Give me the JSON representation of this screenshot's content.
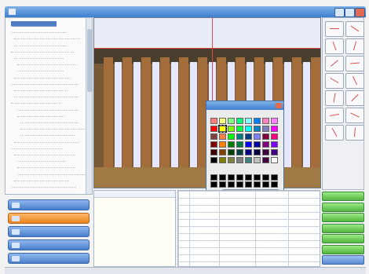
{
  "window": {
    "title": ""
  },
  "tree": {
    "rows": [
      "",
      "",
      "",
      "",
      "",
      "",
      "",
      "",
      "",
      "",
      "",
      "",
      "",
      "",
      "",
      "",
      "",
      "",
      "",
      "",
      "",
      "",
      "",
      "",
      "",
      ""
    ]
  },
  "left_buttons": [
    {
      "label": "",
      "icon": "camera-icon"
    },
    {
      "label": "",
      "icon": "measure-icon"
    },
    {
      "label": "",
      "icon": "folder-icon"
    },
    {
      "label": "",
      "icon": "image-icon"
    },
    {
      "label": "",
      "icon": "report-icon"
    }
  ],
  "toolbar": {
    "tools": [
      "pointer-tool-icon",
      "zoom-tool-icon",
      "line-tool-icon",
      "rect-tool-icon",
      "circle-tool-icon",
      "arc-tool-icon",
      "angle-tool-icon",
      "polygon-tool-icon",
      "curve-tool-icon",
      "text-tool-icon",
      "cross-tool-icon",
      "count-tool-icon",
      "point-tool-icon",
      "area-tool-icon"
    ]
  },
  "color_dialog": {
    "title": "",
    "basic_label": "",
    "custom_label": "",
    "define_label": "",
    "ok_label": "",
    "cancel_label": "",
    "basic_colors": [
      "#ff8080",
      "#ffff80",
      "#80ff80",
      "#00ff80",
      "#80ffff",
      "#0080ff",
      "#ff80c0",
      "#ff80ff",
      "#ff0000",
      "#ffff00",
      "#80ff00",
      "#00ff40",
      "#00ffff",
      "#0080c0",
      "#8080c0",
      "#ff00ff",
      "#804040",
      "#ff8040",
      "#00ff00",
      "#008080",
      "#004080",
      "#8080ff",
      "#800040",
      "#ff0080",
      "#800000",
      "#ff8000",
      "#008000",
      "#008040",
      "#0000ff",
      "#0000a0",
      "#800080",
      "#8000ff",
      "#400000",
      "#804000",
      "#004000",
      "#004040",
      "#000080",
      "#000040",
      "#400040",
      "#400080",
      "#000000",
      "#808000",
      "#808040",
      "#808080",
      "#408080",
      "#c0c0c0",
      "#400040",
      "#ffffff"
    ],
    "custom_colors": [
      "#000000",
      "#000000",
      "#000000",
      "#000000",
      "#000000",
      "#000000",
      "#000000",
      "#000000",
      "#000000",
      "#000000",
      "#000000",
      "#000000",
      "#000000",
      "#000000",
      "#000000",
      "#000000"
    ]
  },
  "panel": {
    "title": ""
  },
  "grid": {
    "columns": [
      "",
      "",
      "",
      ""
    ],
    "rows": [
      "",
      "",
      "",
      "",
      "",
      "",
      "",
      "",
      ""
    ]
  },
  "right_buttons": [
    {
      "label": "",
      "style": "green"
    },
    {
      "label": "",
      "style": "green"
    },
    {
      "label": "",
      "style": "green"
    },
    {
      "label": "",
      "style": "green"
    },
    {
      "label": "",
      "style": "green"
    },
    {
      "label": "",
      "style": "green"
    },
    {
      "label": "",
      "style": "blue"
    }
  ],
  "statusbar": {
    "left": "",
    "center": "",
    "right": ""
  }
}
